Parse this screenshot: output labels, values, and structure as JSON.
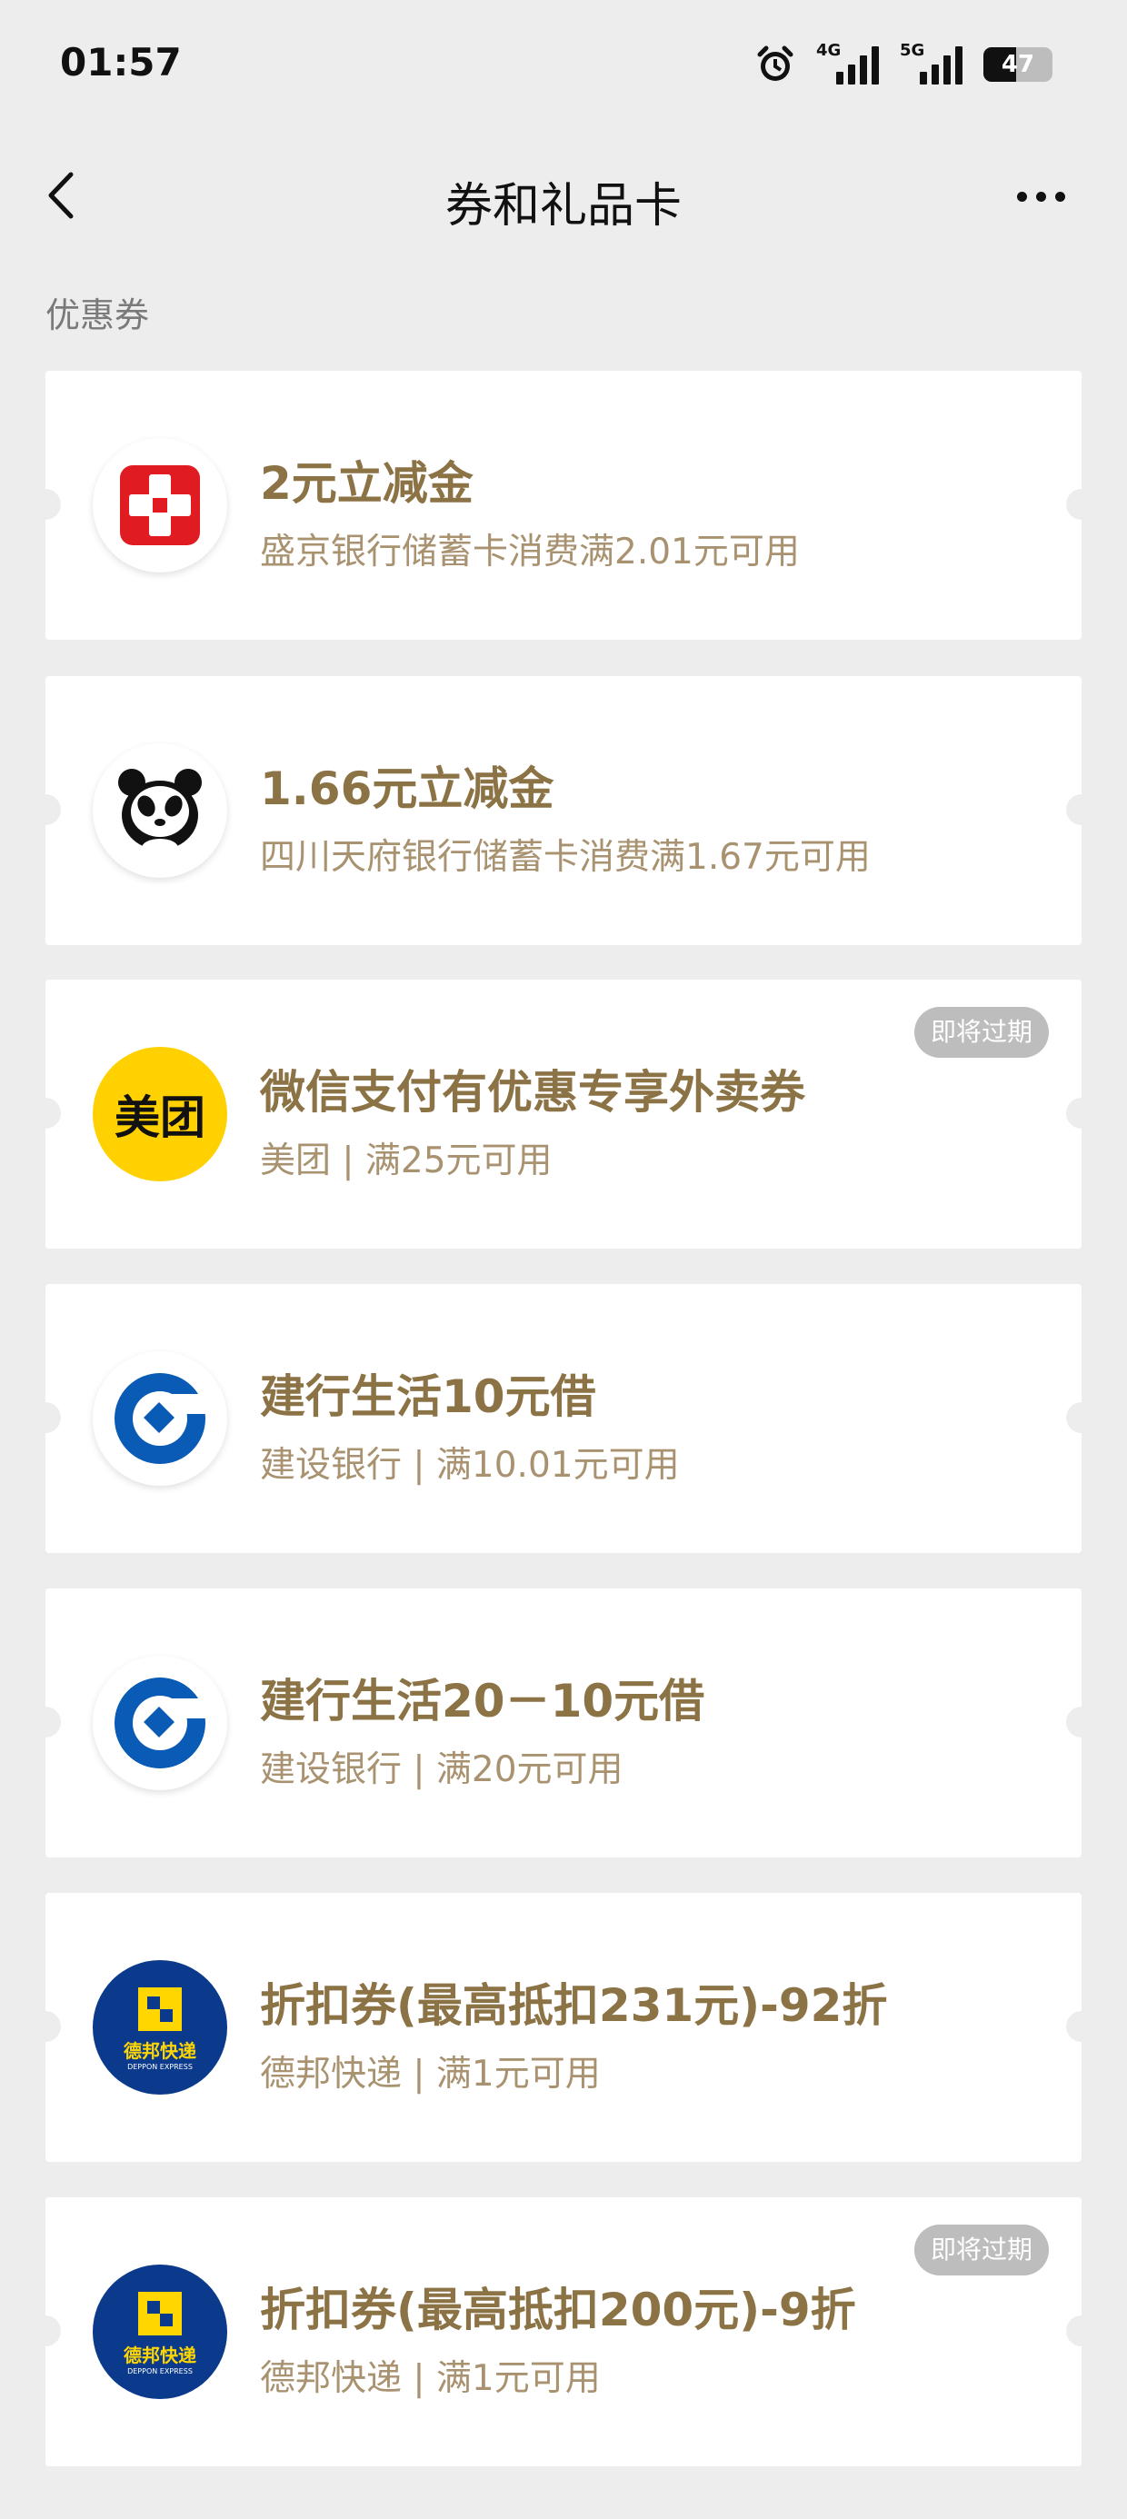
{
  "status_bar": {
    "time": "01:57",
    "net1": "4G",
    "net2": "5G",
    "battery": "47",
    "battery_level": 0.47
  },
  "header": {
    "title": "券和礼品卡"
  },
  "section": {
    "label": "优惠券"
  },
  "coupons": [
    {
      "title": "2元立减金",
      "desc": "盛京银行储蓄卡消费满2.01元可用",
      "logo": "shengjing-bank-logo"
    },
    {
      "title": "1.66元立减金",
      "desc": "四川天府银行储蓄卡消费满1.67元可用",
      "logo": "panda-logo"
    },
    {
      "title": "微信支付有优惠专享外卖券",
      "desc": "美团 | 满25元可用",
      "logo": "meituan-logo",
      "logo_text": "美团",
      "badge": "即将过期"
    },
    {
      "title": "建行生活10元借",
      "desc": "建设银行 | 满10.01元可用",
      "logo": "ccb-logo"
    },
    {
      "title": "建行生活20－10元借",
      "desc": "建设银行 | 满20元可用",
      "logo": "ccb-logo"
    },
    {
      "title": "折扣券(最高抵扣231元)-92折",
      "desc": "德邦快递 | 满1元可用",
      "logo": "deppon-logo",
      "logo_text": "德邦快递",
      "logo_sub": "DEPPON EXPRESS"
    },
    {
      "title": "折扣券(最高抵扣200元)-9折",
      "desc": "德邦快递 | 满1元可用",
      "logo": "deppon-logo",
      "logo_text": "德邦快递",
      "logo_sub": "DEPPON EXPRESS",
      "badge": "即将过期"
    }
  ],
  "colors": {
    "background": "#ededed",
    "title": "#8c7345",
    "desc": "#a99270",
    "badge": "#bdbdbd"
  }
}
